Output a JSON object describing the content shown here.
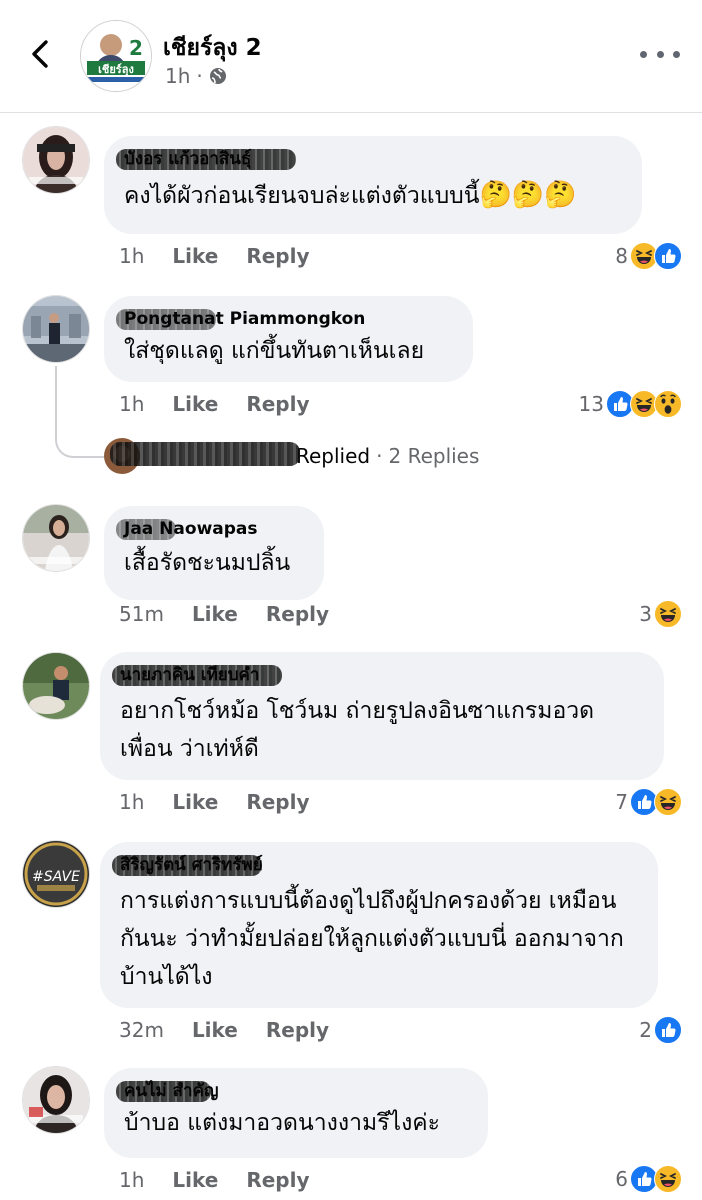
{
  "header": {
    "page_name": "เชียร์ลุง 2",
    "time": "1h",
    "dot": "·",
    "avatar_text_top": "2",
    "avatar_text_main": "เชียร์ลุง"
  },
  "comments": [
    {
      "author": "บังอร แก้วอาสินธุ์",
      "text": "คงได้ผัวก่อนเรียนจบล่ะแต่งตัวแบบนี้",
      "emoji": "🤔🤔🤔",
      "time": "1h",
      "like": "Like",
      "reply": "Reply",
      "reaction_count": "8"
    },
    {
      "author": "Pongtanat Piammongkon",
      "text": "ใส่ชุดแลดู แก่ขึ้นทันตาเห็นเลย",
      "time": "1h",
      "like": "Like",
      "reply": "Reply",
      "reaction_count": "13",
      "replies": {
        "label": "Replied",
        "dot": "·",
        "count": "2 Replies"
      }
    },
    {
      "author": "Jaa Naowapas",
      "text": "เสื้อรัดชะนมปลิ้น",
      "time": "51m",
      "like": "Like",
      "reply": "Reply",
      "reaction_count": "3"
    },
    {
      "author": "นายภาคิน เทียบคำ",
      "text": "อยากโชว์หม้อ โชว์นม ถ่ายรูปลงอินซาแกรมอวดเพื่อน ว่าเท่ห์ดี",
      "time": "1h",
      "like": "Like",
      "reply": "Reply",
      "reaction_count": "7"
    },
    {
      "author": "สิริญรัตน์ ศาริทรัพย์",
      "text": "การแต่งการแบบนี้ต้องดูไปถึงผู้ปกครองด้วย เหมือนกันนะ ว่าทำมั้ยปล่อยให้ลูกแต่งตัวแบบนี่ ออกมาจากบ้านได้ไง",
      "time": "32m",
      "like": "Like",
      "reply": "Reply",
      "reaction_count": "2"
    },
    {
      "author": "คนไม่ สำคัญ",
      "text": "บ้าบอ แต่งมาอวดนางงามรึไงค่ะ",
      "time": "1h",
      "like": "Like",
      "reply": "Reply",
      "reaction_count": "6"
    }
  ],
  "colors": {
    "bubble": "#f0f2f5",
    "like_blue": "#1877f2",
    "haha_yellow": "#f7b928",
    "meta_gray": "#65676b"
  },
  "icons": [
    "back-arrow-icon",
    "globe-icon",
    "more-icon",
    "like-reaction-icon",
    "haha-reaction-icon",
    "wow-reaction-icon"
  ]
}
